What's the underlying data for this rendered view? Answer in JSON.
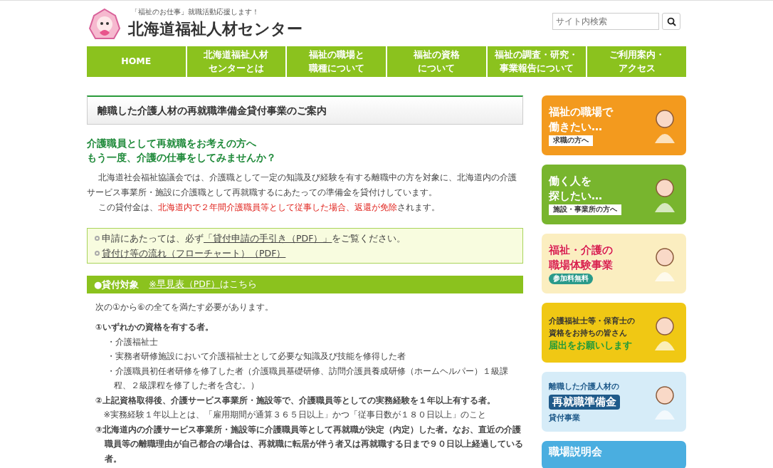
{
  "header": {
    "tagline": "「福祉のお仕事」就職活動応援します！",
    "site_title": "北海道福祉人材センター",
    "search": {
      "placeholder": "サイト内検索"
    }
  },
  "nav": [
    {
      "lines": [
        "HOME"
      ]
    },
    {
      "lines": [
        "北海道福祉人材",
        "センターとは"
      ]
    },
    {
      "lines": [
        "福祉の職場と",
        "職種について"
      ]
    },
    {
      "lines": [
        "福祉の資格",
        "について"
      ]
    },
    {
      "lines": [
        "福祉の調査・研究・",
        "事業報告について"
      ]
    },
    {
      "lines": [
        "ご利用案内・",
        "アクセス"
      ]
    }
  ],
  "page_title": "離職した介護人材の再就職準備金貸付事業のご案内",
  "lead": [
    "介護職員として再就職をお考えの方へ",
    "もう一度、介護の仕事をしてみませんか？"
  ],
  "intro": [
    [
      {
        "text": "北海道社会福祉協議会では、介護職として一定の知識及び経験を有する離職中の方を対象に、北海道内の介護サービス事業所・施設に介護職として再就職するにあたっての準備金を貸付けしています。",
        "highlight": false
      }
    ],
    [
      {
        "text": "この貸付金は、",
        "highlight": false
      },
      {
        "text": "北海道内で２年間介護職員等として従事した場合、返還が免除",
        "highlight": true
      },
      {
        "text": "されます。",
        "highlight": false
      }
    ]
  ],
  "notices": [
    {
      "before": "申請にあたっては、必ず",
      "link": "「貸付申請の手引き（PDF）」",
      "after": "をご覧ください。"
    },
    {
      "link": "貸付け等の流れ（フローチャート）（PDF）"
    }
  ],
  "section": {
    "title": "●貸付対象",
    "link": "※早見表（PDF）",
    "after": "はこちら"
  },
  "section_intro": "次の①から⑥の全てを満たす必要があります。",
  "requirements": [
    {
      "text": "①いずれかの資格を有する者。",
      "items": [
        "・介護福祉士",
        "・実務者研修施設において介護福祉士として必要な知識及び技能を修得した者",
        "・介護職員初任者研修を修了した者（介護職員基礎研修、訪問介護員養成研修（ホームヘルパー）１級課程、２級課程を修了した者を含む。）"
      ]
    },
    {
      "text": "②上記資格取得後、介護サービス事業所・施設等で、介護職員等としての実務経験を１年以上有する者。",
      "notes": [
        "※実務経験１年以上とは、「雇用期間が通算３６５日以上」かつ「従事日数が１８０日以上」のこと"
      ]
    },
    {
      "text": "③北海道内の介護サービス事業所・施設等に介護職員等として再就職が決定（内定）した者。なお、直近の介護職員等の離職理由が自己都合の場合は、再就職に転居が伴う者又は再就職する日まで９０日以上経過している者。"
    }
  ],
  "banners": [
    {
      "kind": "job-seeker",
      "color": "#f39a1e",
      "lines": [
        "福祉の職場で",
        "働きたい…"
      ],
      "tag": "求職の方へ"
    },
    {
      "kind": "employer",
      "color": "#78b52e",
      "lines": [
        "働く人を",
        "探したい…"
      ],
      "tag": "施設・事業所の方へ"
    },
    {
      "kind": "experience",
      "color": "#fbeec0",
      "lines": [
        "福祉・介護の",
        "職場体験事業"
      ],
      "tag": "参加料無料"
    },
    {
      "kind": "register",
      "color": "#f0c814",
      "lines": [
        "介護福祉士等・保育士の",
        "資格をお持ちの皆さん",
        "届出をお願いします"
      ]
    },
    {
      "kind": "loan",
      "color": "#d6ecf8",
      "lines": [
        "離職した介護人材の",
        "再就職準備金",
        "貸付事業"
      ]
    },
    {
      "kind": "seminar",
      "color": "#4aaee0",
      "lines": [
        "職場説明会"
      ]
    }
  ]
}
